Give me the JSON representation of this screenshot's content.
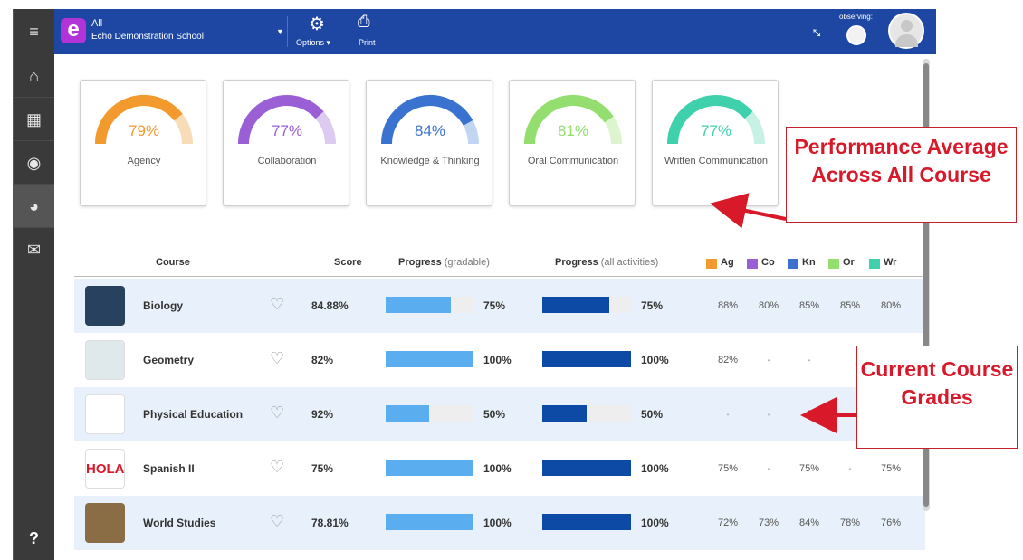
{
  "header": {
    "context_title": "All",
    "context_subtitle": "Echo Demonstration School",
    "options_label": "Options",
    "print_label": "Print",
    "observing_label": "observing:"
  },
  "sidebar": {
    "items": [
      {
        "icon": "home-icon"
      },
      {
        "icon": "calendar-icon"
      },
      {
        "icon": "play-icon"
      },
      {
        "icon": "dashboard-icon",
        "active": true
      },
      {
        "icon": "mail-icon"
      }
    ],
    "help_label": "?"
  },
  "cards": [
    {
      "pct": "79%",
      "label": "Agency",
      "value": 0.79,
      "color": "#f29a2e",
      "light": "#f7dcb7"
    },
    {
      "pct": "77%",
      "label": "Collaboration",
      "value": 0.77,
      "color": "#9a5fd5",
      "light": "#dccaf0"
    },
    {
      "pct": "84%",
      "label": "Knowledge & Thinking",
      "value": 0.84,
      "color": "#3a73cf",
      "light": "#c2d6f3"
    },
    {
      "pct": "81%",
      "label": "Oral Communication",
      "value": 0.81,
      "color": "#94de70",
      "light": "#dcf5cf"
    },
    {
      "pct": "77%",
      "label": "Written Communication",
      "value": 0.77,
      "color": "#3fd1ac",
      "light": "#c6f1e4"
    }
  ],
  "table": {
    "headers": {
      "course": "Course",
      "score": "Score",
      "progress1_bold": "Progress",
      "progress1_light": "(gradable)",
      "progress2_bold": "Progress",
      "progress2_light": "(all activities)"
    },
    "legend": [
      {
        "code": "Ag",
        "color": "#f29a2e"
      },
      {
        "code": "Co",
        "color": "#9a5fd5"
      },
      {
        "code": "Kn",
        "color": "#3a73cf"
      },
      {
        "code": "Or",
        "color": "#94de70"
      },
      {
        "code": "Wr",
        "color": "#3fd1ac"
      }
    ],
    "rows": [
      {
        "course": "Biology",
        "score": "84.88%",
        "progress_gradable": "75%",
        "gradable_value": 0.75,
        "progress_all": "75%",
        "all_value": 0.75,
        "grades": [
          "88%",
          "80%",
          "85%",
          "85%",
          "80%"
        ],
        "thumb_color": "#27415f"
      },
      {
        "course": "Geometry",
        "score": "82%",
        "progress_gradable": "100%",
        "gradable_value": 1.0,
        "progress_all": "100%",
        "all_value": 1.0,
        "grades": [
          "82%",
          "-",
          "-",
          "",
          ""
        ],
        "thumb_color": "#dfe8ea"
      },
      {
        "course": "Physical Education",
        "score": "92%",
        "progress_gradable": "50%",
        "gradable_value": 0.5,
        "progress_all": "50%",
        "all_value": 0.5,
        "grades": [
          "-",
          "-",
          "9",
          "",
          ""
        ],
        "thumb_color": "#ffffff"
      },
      {
        "course": "Spanish II",
        "score": "75%",
        "progress_gradable": "100%",
        "gradable_value": 1.0,
        "progress_all": "100%",
        "all_value": 1.0,
        "grades": [
          "75%",
          "-",
          "75%",
          "-",
          "75%"
        ],
        "thumb_color": "#ffffff"
      },
      {
        "course": "World Studies",
        "score": "78.81%",
        "progress_gradable": "100%",
        "gradable_value": 1.0,
        "progress_all": "100%",
        "all_value": 1.0,
        "grades": [
          "72%",
          "73%",
          "84%",
          "78%",
          "76%"
        ],
        "thumb_color": "#8a6d45"
      }
    ]
  },
  "callouts": {
    "performance": "Performance Average Across All Course",
    "grades": "Current Course Grades"
  },
  "spanish_logo_text": "HOLA"
}
